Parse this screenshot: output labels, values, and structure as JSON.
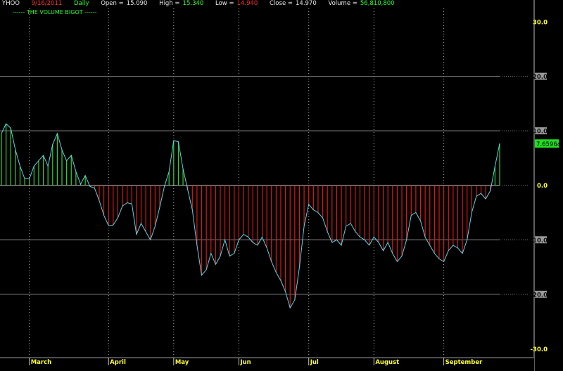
{
  "header": {
    "symbol": "YHOO",
    "date": "9/16/2011",
    "period": "Daily",
    "open_label": "Open =",
    "open_value": "15.090",
    "high_label": "High =",
    "high_value": "15.340",
    "low_label": "Low =",
    "low_value": "14.940",
    "close_label": "Close =",
    "close_value": "14.970",
    "volume_label": "Volume =",
    "volume_value": "56,810,800"
  },
  "indicator_label": "------ THE VOLUME BIGOT ------",
  "colors": {
    "background": "#000000",
    "line": "#5fd3e6",
    "positive_fill": "#2fd52f",
    "negative_fill": "#e01818",
    "gridline": "#8a8a8a",
    "zero_line": "#c8c8c8",
    "axis_text": "#ffff33",
    "last_value_badge": "#22dd22"
  },
  "chart_data": {
    "type": "area",
    "ylim": [
      -31.5,
      34
    ],
    "y_ticks": [
      "30.0",
      "20.0",
      "10.0",
      "0.0",
      "-10.0",
      "-20.0",
      "-30.0"
    ],
    "y_tick_values": [
      30,
      20,
      10,
      0,
      -10,
      -20,
      -30
    ],
    "boxed_ticks": [
      20,
      10,
      -10,
      -20
    ],
    "grid_lines": [
      20,
      10,
      0,
      -10,
      -20
    ],
    "x_labels": [
      "March",
      "April",
      "May",
      "Jun",
      "Jul",
      "August",
      "September"
    ],
    "x_label_index": [
      6,
      23,
      37,
      51,
      66,
      80,
      95
    ],
    "last_value": "7.65964",
    "values": [
      9.5,
      11.3,
      10.5,
      6.5,
      3.5,
      1.2,
      1.2,
      3.5,
      4.5,
      5.5,
      3.5,
      7.5,
      9.5,
      6.5,
      4.5,
      5.5,
      2.5,
      0.2,
      1.8,
      -0.2,
      -0.5,
      -2.8,
      -5.5,
      -7.4,
      -7.3,
      -6.0,
      -3.8,
      -3.2,
      -3.4,
      -9.0,
      -7.0,
      -8.5,
      -10.0,
      -7.5,
      -4.0,
      -0.2,
      2.5,
      8.2,
      8.0,
      3.0,
      -0.8,
      -4.5,
      -11.0,
      -16.5,
      -15.5,
      -12.5,
      -14.5,
      -13.0,
      -10.0,
      -13.0,
      -12.5,
      -10.0,
      -9.0,
      -9.5,
      -10.5,
      -11.0,
      -9.5,
      -11.5,
      -14.0,
      -16.0,
      -17.5,
      -19.5,
      -22.5,
      -21.0,
      -15.0,
      -7.5,
      -3.5,
      -4.5,
      -5.0,
      -6.0,
      -8.5,
      -10.5,
      -10.0,
      -11.0,
      -7.5,
      -7.0,
      -8.5,
      -9.5,
      -10.0,
      -11.0,
      -9.5,
      -10.5,
      -12.0,
      -10.5,
      -12.5,
      -14.0,
      -13.0,
      -10.0,
      -5.5,
      -5.0,
      -6.5,
      -9.5,
      -11.0,
      -12.5,
      -13.5,
      -14.0,
      -12.0,
      -11.0,
      -11.5,
      -12.5,
      -10.0,
      -5.0,
      -2.0,
      -1.5,
      -2.5,
      -1.0,
      3.5,
      7.66
    ]
  }
}
